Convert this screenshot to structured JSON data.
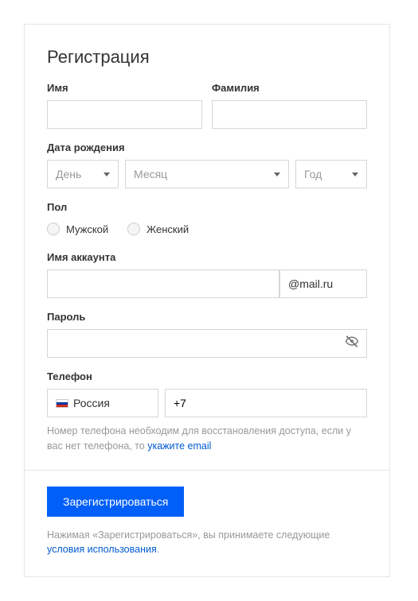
{
  "title": "Регистрация",
  "firstName": {
    "label": "Имя",
    "value": ""
  },
  "lastName": {
    "label": "Фамилия",
    "value": ""
  },
  "dob": {
    "label": "Дата рождения",
    "day": "День",
    "month": "Месяц",
    "year": "Год"
  },
  "gender": {
    "label": "Пол",
    "male": "Мужской",
    "female": "Женский"
  },
  "account": {
    "label": "Имя аккаунта",
    "value": "",
    "domain": "@mail.ru"
  },
  "password": {
    "label": "Пароль",
    "value": ""
  },
  "phone": {
    "label": "Телефон",
    "country": "Россия",
    "prefix": "+7",
    "hint_pre": "Номер телефона необходим для восстановления доступа, если у вас нет телефона, то ",
    "hint_link": "укажите email"
  },
  "submit": "Зарегистрироваться",
  "terms": {
    "pre": "Нажимая «Зарегистрироваться», вы принимаете следующие ",
    "link": "условия использования",
    "post": "."
  }
}
